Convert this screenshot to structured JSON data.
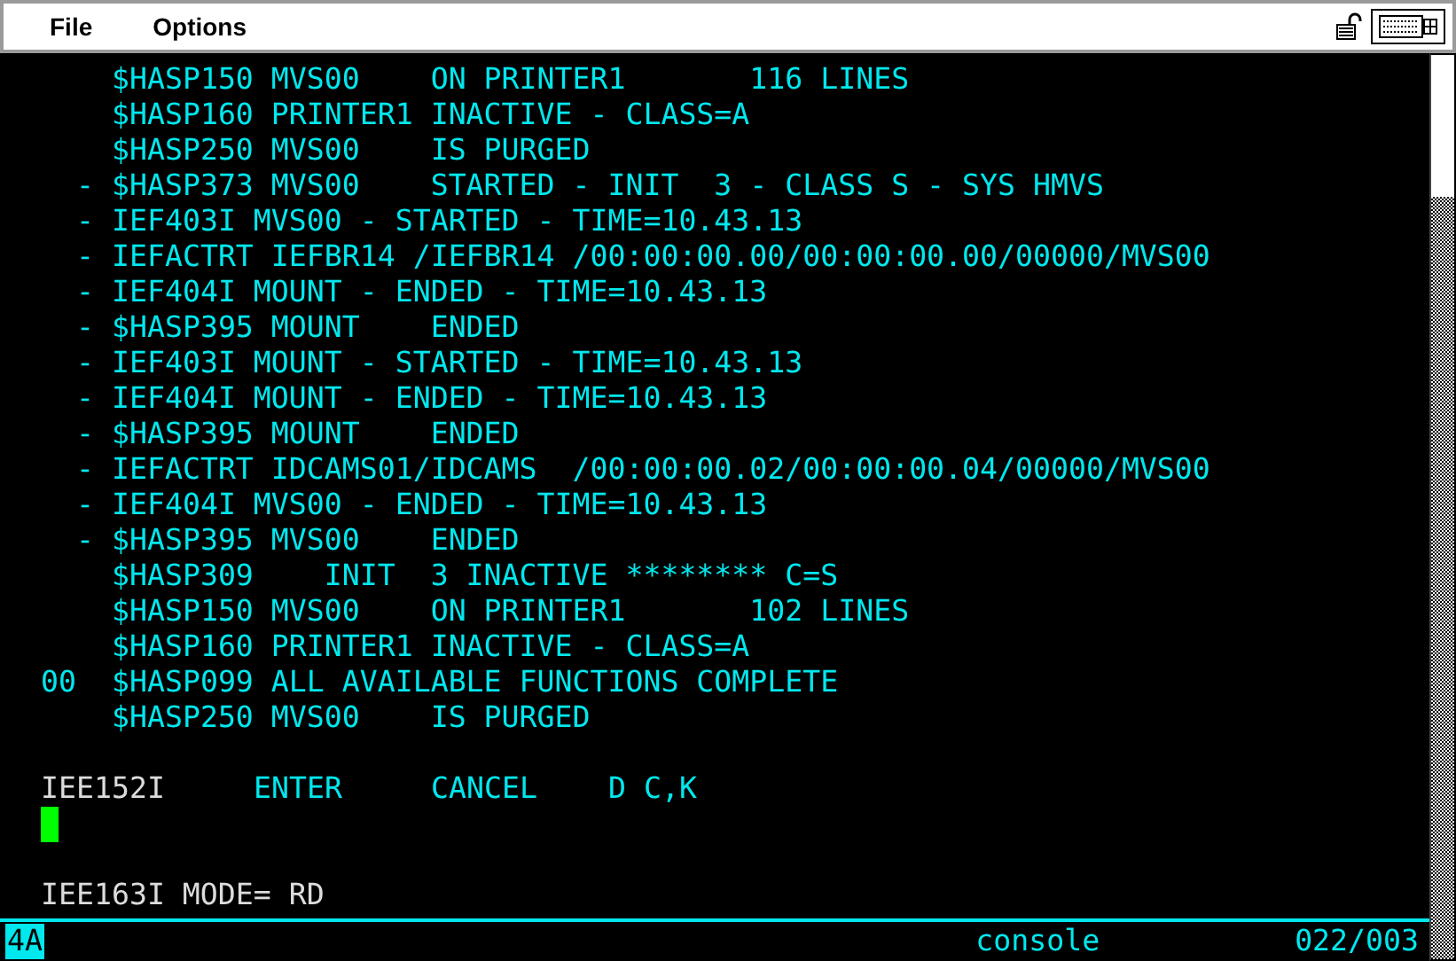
{
  "menu": [
    {
      "label": "File"
    },
    {
      "label": "Options"
    }
  ],
  "messages": [
    {
      "text": "$HASP150 MVS00    ON PRINTER1       116 LINES"
    },
    {
      "text": "$HASP160 PRINTER1 INACTIVE - CLASS=A"
    },
    {
      "text": "$HASP250 MVS00    IS PURGED"
    },
    {
      "prefix": "-",
      "text": "$HASP373 MVS00    STARTED - INIT  3 - CLASS S - SYS HMVS"
    },
    {
      "prefix": "-",
      "text": "IEF403I MVS00 - STARTED - TIME=10.43.13"
    },
    {
      "prefix": "-",
      "text": "IEFACTRT IEFBR14 /IEFBR14 /00:00:00.00/00:00:00.00/00000/MVS00"
    },
    {
      "prefix": "-",
      "text": "IEF404I MOUNT - ENDED - TIME=10.43.13"
    },
    {
      "prefix": "-",
      "text": "$HASP395 MOUNT    ENDED"
    },
    {
      "prefix": "-",
      "text": "IEF403I MOUNT - STARTED - TIME=10.43.13"
    },
    {
      "prefix": "-",
      "text": "IEF404I MOUNT - ENDED - TIME=10.43.13"
    },
    {
      "prefix": "-",
      "text": "$HASP395 MOUNT    ENDED"
    },
    {
      "prefix": "-",
      "text": "IEFACTRT IDCAMS01/IDCAMS  /00:00:00.02/00:00:00.04/00000/MVS00"
    },
    {
      "prefix": "-",
      "text": "IEF404I MVS00 - ENDED - TIME=10.43.13"
    },
    {
      "prefix": "-",
      "text": "$HASP395 MVS00    ENDED"
    },
    {
      "text": "$HASP309    INIT  3 INACTIVE ******** C=S"
    },
    {
      "text": "$HASP150 MVS00    ON PRINTER1       102 LINES"
    },
    {
      "text": "$HASP160 PRINTER1 INACTIVE - CLASS=A"
    },
    {
      "prefix": "00",
      "text": "$HASP099 ALL AVAILABLE FUNCTIONS COMPLETE"
    },
    {
      "text": "$HASP250 MVS00    IS PURGED"
    }
  ],
  "prompt": {
    "id": "IEE152I",
    "options": [
      "ENTER",
      "CANCEL",
      "D C,K"
    ]
  },
  "mode_line": "IEE163I MODE= RD",
  "status_bar": {
    "indicator": "4A",
    "session": "console",
    "position": "022/003"
  }
}
